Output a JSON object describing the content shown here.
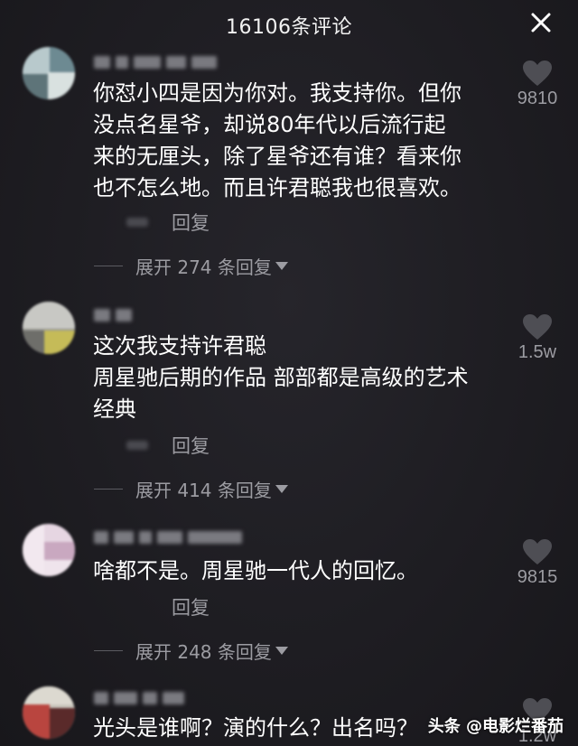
{
  "header": {
    "title": "16106条评论",
    "close_icon": "close-icon"
  },
  "comments": [
    {
      "text": "你怼小四是因为你对。我支持你。但你\n没点名星爷，却说80年代以后流行起\n来的无厘头，除了星爷还有谁？看来你\n也不怎么地。而且许君聪我也很喜欢。",
      "reply_label": "回复",
      "expand_label": "展开 274 条回复",
      "likes": "9810"
    },
    {
      "text": "这次我支持许君聪\n周星驰后期的作品 部部都是高级的艺术\n经典",
      "reply_label": "回复",
      "expand_label": "展开 414 条回复",
      "likes": "1.5w"
    },
    {
      "text": "啥都不是。周星驰一代人的回忆。",
      "reply_label": "回复",
      "expand_label": "展开 248 条回复",
      "likes": "9815"
    },
    {
      "text": "光头是谁啊？演的什么？出名吗？",
      "likes": "1.2w"
    }
  ],
  "watermark": "头条 @电影烂番茄",
  "colors": {
    "background": "#1e1d22",
    "secondary_text": "#9c9ca2",
    "heart": "#4e4e54"
  }
}
